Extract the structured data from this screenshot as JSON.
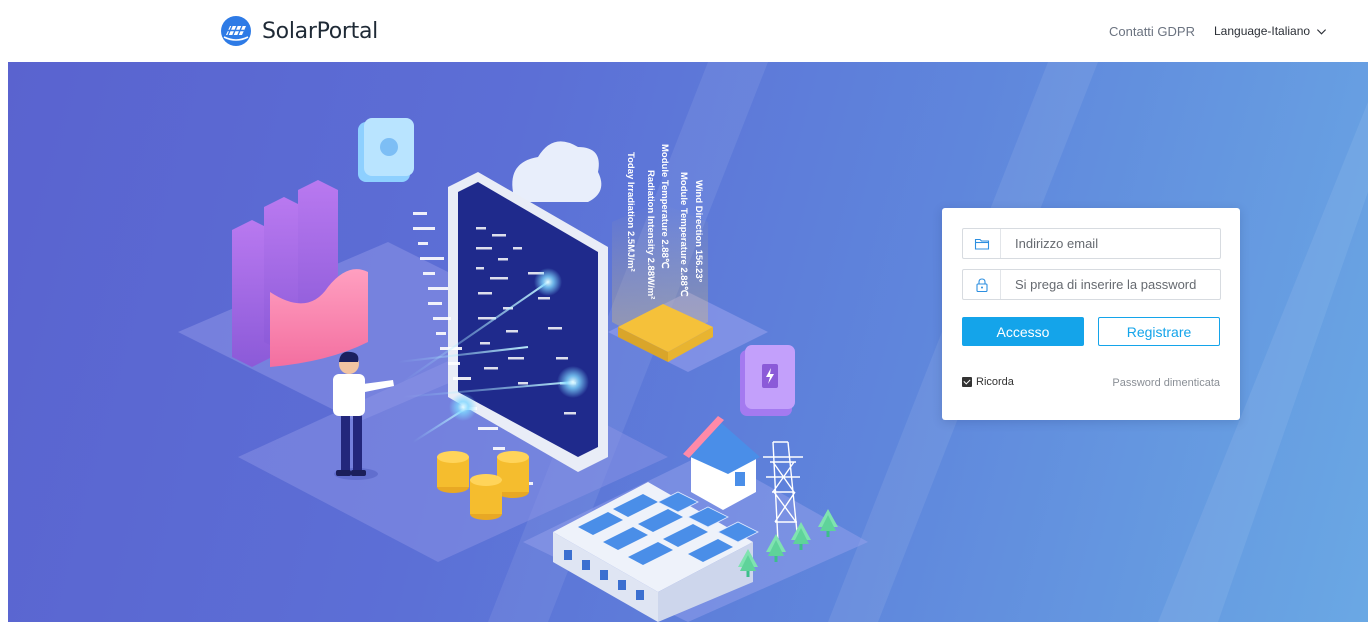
{
  "header": {
    "brand": "SolarPortal",
    "gdpr_link": "Contatti GDPR",
    "language_label": "Language-Italiano"
  },
  "hero": {
    "readings": [
      "Wind Direction 156.23°",
      "Module Temperature 2.88℃",
      "Module Temperature 2.88℃",
      "Radiation Intensity 2.88W/m²",
      "Today Irradiation 2.5MJ/m²"
    ]
  },
  "login": {
    "email_placeholder": "Indirizzo email",
    "password_placeholder": "Si prega di inserire la password",
    "login_button": "Accesso",
    "register_button": "Registrare",
    "remember_label": "Ricorda",
    "remember_checked": true,
    "forgot_link": "Password dimenticata"
  },
  "colors": {
    "accent": "#14a4ea",
    "hero_start": "#5a63cf",
    "hero_end": "#6aa8e4"
  }
}
